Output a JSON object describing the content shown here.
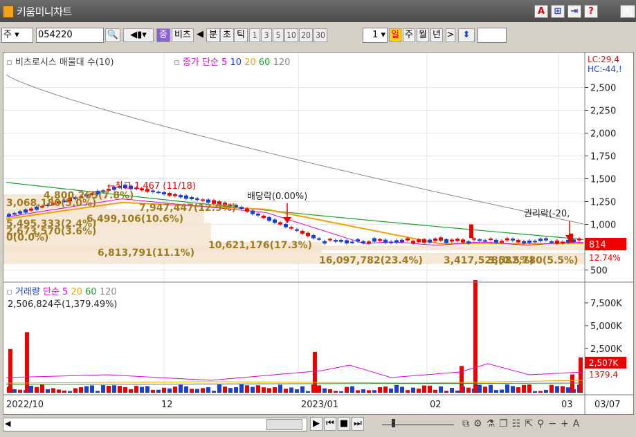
{
  "window": {
    "title": "키움미니차트",
    "buttons": [
      "A",
      "⊞",
      "⇥",
      "?",
      "×"
    ]
  },
  "toolbar": {
    "market_type": "주",
    "code": "054220",
    "active_tab": "증",
    "stock_name": "비츠",
    "prev_arrow": "◀",
    "period_labels": [
      "분",
      "초",
      "틱"
    ],
    "numbers": [
      "1",
      "3",
      "5",
      "10",
      "20",
      "30"
    ],
    "count": "1",
    "day": "일",
    "week": "주",
    "month": "월",
    "year": "년",
    "next_arrow": ">",
    "updown": "⬍"
  },
  "price_panel": {
    "stock_label": "비츠로시스 매물대 수(10)",
    "ma_label": "종가 단순",
    "ma_periods": [
      "5",
      "10",
      "20",
      "60",
      "120"
    ],
    "ma_colors": [
      "#e000e0",
      "#1a3fd1",
      "#f0a000",
      "#18a028",
      "#888888"
    ],
    "lc": "LC:29,4",
    "hc": "HC:-44,!",
    "y_ticks": [
      "2,500",
      "2,250",
      "2,000",
      "1,750",
      "1,500",
      "1,250",
      "1,000",
      "750",
      "500"
    ],
    "high_annotation": "←최고 1,467 (11/18)",
    "dividend_annotation": "배당락(0.00%)",
    "rights_annotation": "권리락(-20,",
    "current_price": "814",
    "current_change": "12.74%",
    "volume_profile_labels": [
      "3,068,180(5.0%)",
      "4,800,265(7.8%)",
      "5,495,333(2.4%)",
      "2,673,570(3.6%)",
      "0(0.0%)",
      "6,499,106(10.6%)",
      "7,947,447(12.9%)",
      "6,813,791(11.1%)",
      "10,621,176(17.3%)",
      "16,097,782(23.4%)",
      "3,417,528(0.5%)",
      "3,582,780(5.5%)"
    ]
  },
  "volume_panel": {
    "label": "거래량",
    "ma_label": "단순",
    "ma_periods": [
      "5",
      "20",
      "60",
      "120"
    ],
    "volume_text": "2,506,824주(1,379.49%)",
    "y_ticks": [
      "7,500K",
      "5,000K",
      "2,500K"
    ],
    "current_volume": "2,507K",
    "current_pct": "1379.4"
  },
  "x_axis": {
    "labels": [
      "2022/10",
      "12",
      "2023/01",
      "02",
      "03",
      "03/07"
    ]
  },
  "chart_data": {
    "type": "candlestick",
    "title": "비츠로시스 매물대 수(10)",
    "x_range": [
      "2022/10",
      "2023/03/07"
    ],
    "ylim": [
      450,
      2700
    ],
    "high_point": {
      "date": "2022/11/18",
      "value": 1467
    },
    "last_close": 814,
    "volume_ylim": [
      0,
      9000000
    ],
    "last_volume": 2506824,
    "series": [
      {
        "name": "120",
        "start": 2640,
        "end": 1005
      },
      {
        "name": "60",
        "start": 1460,
        "end": 835
      },
      {
        "name": "20",
        "start": 1060,
        "end": 790
      },
      {
        "name": "5",
        "start": 1060,
        "end": 780
      }
    ]
  },
  "status": {
    "scroll_left": "◀",
    "controls": [
      "▶",
      "⏮",
      "■",
      "⏭"
    ]
  }
}
